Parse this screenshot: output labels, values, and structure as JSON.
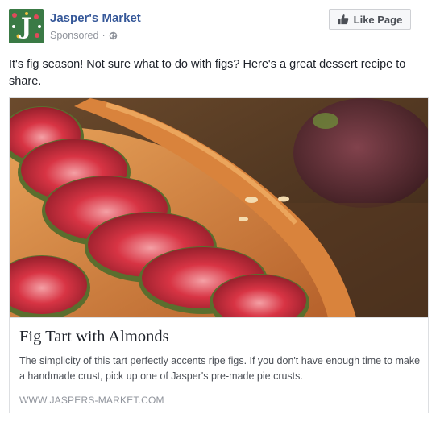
{
  "page": {
    "name": "Jasper's Market",
    "sponsored_label": "Sponsored",
    "separator": "·"
  },
  "icons": {
    "privacy": "globe-icon",
    "like": "thumbs-up-icon"
  },
  "like_button": {
    "label": "Like Page"
  },
  "post": {
    "text": "It's fig season! Not sure what to do with figs? Here's a great dessert recipe to share."
  },
  "link": {
    "title": "Fig Tart with Almonds",
    "description": "The simplicity of this tart perfectly accents ripe figs. If you don't have enough time to make a handmade crust, pick up one of Jasper's pre-made pie crusts.",
    "domain": "WWW.JASPERS-MARKET.COM"
  },
  "colors": {
    "brand_link": "#365899",
    "avatar_bg": "#2e6b3a",
    "fig_red": "#c8283a",
    "pastry": "#d98a3e"
  }
}
